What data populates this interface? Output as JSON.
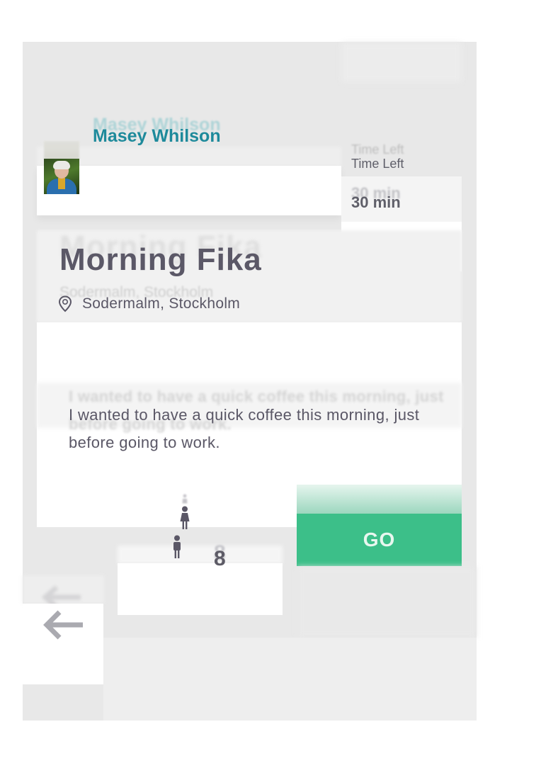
{
  "host": {
    "name": "Masey Whilson"
  },
  "time": {
    "label": "Time Left",
    "value": "30 min"
  },
  "event": {
    "title": "Morning Fika",
    "location": "Sodermalm, Stockholm",
    "description": "I wanted to have a quick coffee this morning, just before going to work."
  },
  "participants": {
    "count": "8"
  },
  "actions": {
    "go_label": "GO"
  },
  "colors": {
    "accent_green": "#3cbf89",
    "name_teal": "#1e8a9b",
    "text_dark": "#5a5766"
  },
  "icons": {
    "location": "map-pin-icon",
    "back": "arrow-left-icon",
    "participant": "person-icon"
  }
}
